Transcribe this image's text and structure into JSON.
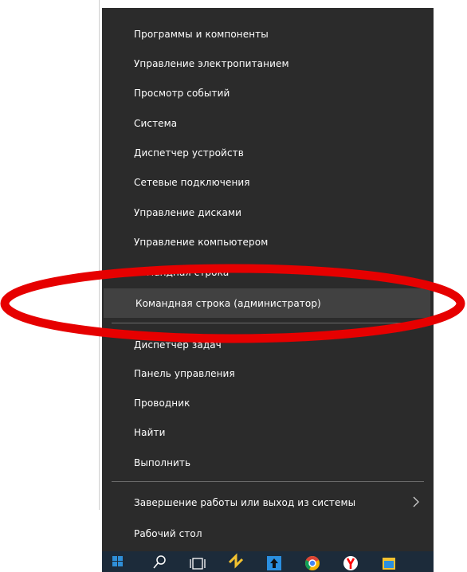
{
  "menu": {
    "items": [
      {
        "label": "Программы и компоненты"
      },
      {
        "label": "Управление электропитанием"
      },
      {
        "label": "Просмотр событий"
      },
      {
        "label": "Система"
      },
      {
        "label": "Диспетчер устройств"
      },
      {
        "label": "Сетевые подключения"
      },
      {
        "label": "Управление дисками"
      },
      {
        "label": "Управление компьютером"
      },
      {
        "label": "Командная строка"
      },
      {
        "label": "Командная строка (администратор)"
      },
      {
        "label": "Диспетчер задач"
      },
      {
        "label": "Панель управления"
      },
      {
        "label": "Проводник"
      },
      {
        "label": "Найти"
      },
      {
        "label": "Выполнить"
      },
      {
        "label": "Завершение работы или выход из системы"
      },
      {
        "label": "Рабочий стол"
      }
    ],
    "highlighted_item": "Командная строка (администратор)",
    "submenu_icon": "chevron-right-icon"
  },
  "taskbar": {
    "icons": [
      "windows-start-icon",
      "search-icon",
      "task-view-icon",
      "app-icon",
      "arrow-app-icon",
      "chrome-icon",
      "yandex-icon",
      "app-icon"
    ]
  },
  "colors": {
    "menu_background": "#2b2b2b",
    "highlight_background": "#414141",
    "annotation_red": "#e60000",
    "taskbar_background": "#1c2b3a"
  }
}
